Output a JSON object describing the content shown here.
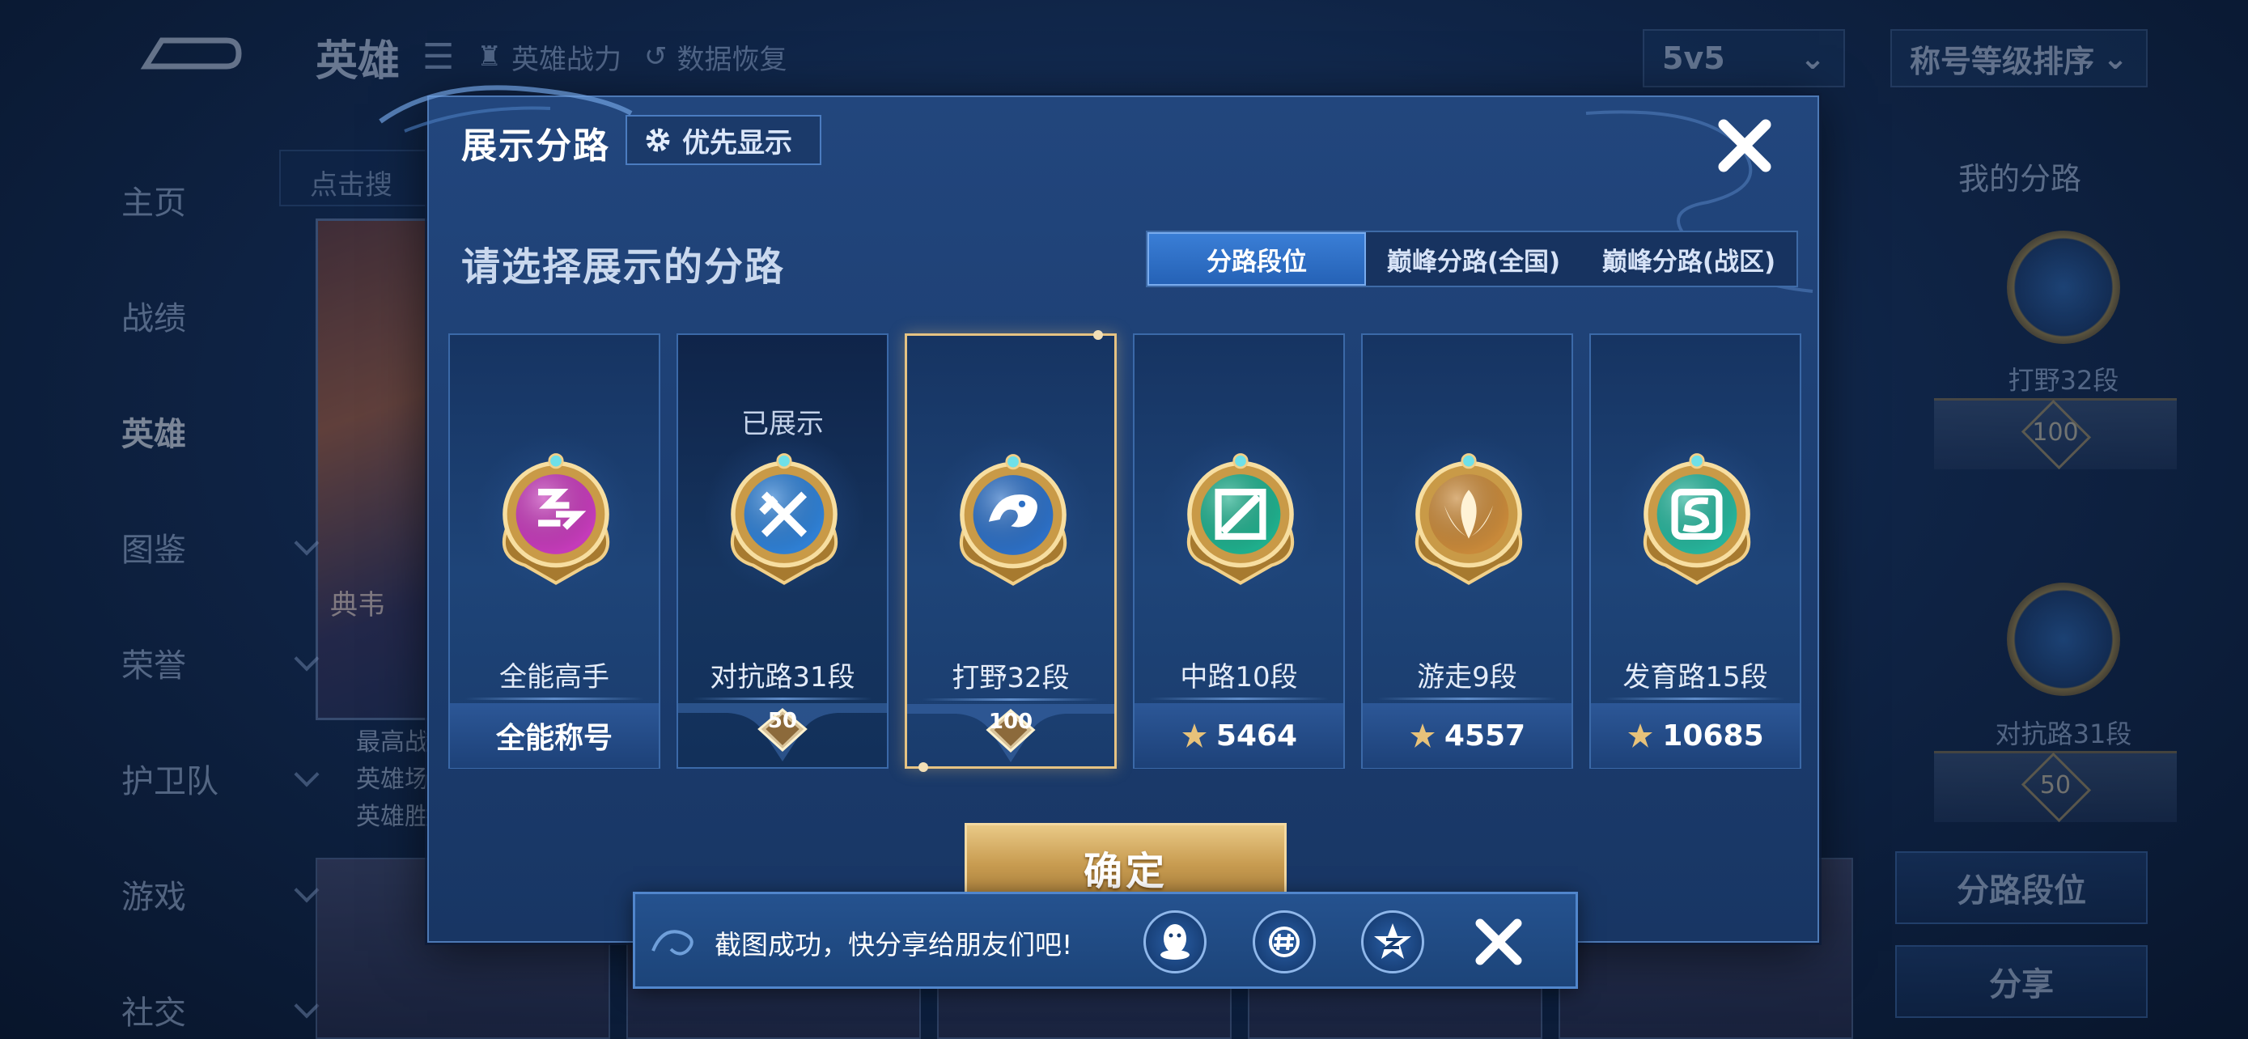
{
  "background": {
    "title": "英雄",
    "chips": [
      "英雄战力",
      "数据恢复"
    ],
    "mode_select": "5v5",
    "sort_select": "称号等级排序",
    "search_placeholder": "点击搜",
    "nav": [
      "主页",
      "战绩",
      "英雄",
      "图鉴",
      "荣誉",
      "护卫队",
      "游戏",
      "社交"
    ],
    "nav_active": "英雄",
    "hero_card_label": "典韦",
    "hero_stats": [
      "最高战",
      "英雄场",
      "英雄胜"
    ],
    "right_panel": {
      "header": "我的分路",
      "lane1": "打野32段",
      "lane1_level": "100",
      "lane2": "对抗路31段",
      "lane2_level": "50",
      "btn_lane_rank": "分路段位",
      "btn_share": "分享"
    }
  },
  "modal": {
    "title": "展示分路",
    "priority_button": "优先显示",
    "prompt": "请选择展示的分路",
    "tabs": [
      {
        "label": "分路段位",
        "active": true
      },
      {
        "label": "巅峰分路(全国)",
        "active": false
      },
      {
        "label": "巅峰分路(战区)",
        "active": false
      }
    ],
    "cards": [
      {
        "name": "全能高手",
        "footer": "全能称号",
        "top": "",
        "medal": "all-rounder-icon",
        "color": "#c43bb9"
      },
      {
        "name": "对抗路31段",
        "level": "50",
        "top": "已展示",
        "medal": "clash-lane-icon",
        "color": "#2f7fd3"
      },
      {
        "name": "打野32段",
        "level": "100",
        "top": "",
        "medal": "jungle-dragon-icon",
        "color": "#2d6fc4",
        "selected": true
      },
      {
        "name": "中路10段",
        "score": "5464",
        "top": "",
        "medal": "mid-lane-icon",
        "color": "#1fae8c"
      },
      {
        "name": "游走9段",
        "score": "4557",
        "top": "",
        "medal": "roam-icon",
        "color": "#c8893a"
      },
      {
        "name": "发育路15段",
        "score": "10685",
        "top": "",
        "medal": "farm-lane-icon",
        "color": "#26b39a"
      }
    ],
    "confirm": "确定"
  },
  "toast": {
    "message": "截图成功，快分享给朋友们吧!",
    "share_icons": [
      "qq-icon",
      "wechat-moments-icon",
      "qzone-icon"
    ]
  }
}
